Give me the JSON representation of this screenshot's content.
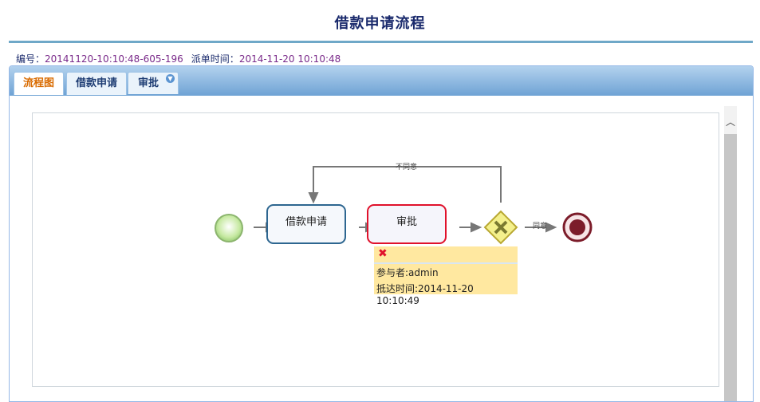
{
  "page": {
    "title": "借款申请流程"
  },
  "meta": {
    "id_label": "编号：",
    "id_value": "20141120-10:10:48-605-196",
    "time_label": "派单时间：",
    "time_value": "2014-11-20 10:10:48"
  },
  "tabs": [
    {
      "label": "流程图",
      "active": true
    },
    {
      "label": "借款申请",
      "active": false
    },
    {
      "label": "审批",
      "active": false
    }
  ],
  "diagram": {
    "task1": "借款申请",
    "task2": "审批",
    "reject_label": "不同意",
    "approve_label": "同意",
    "popup": {
      "participant": "参与者:admin",
      "arrival": "抵达时间:2014-11-20 10:10:49"
    }
  },
  "colors": {
    "accent": "#6fa8c8",
    "task_highlight": "#e0112b",
    "popup_bg": "#ffe8a0"
  }
}
